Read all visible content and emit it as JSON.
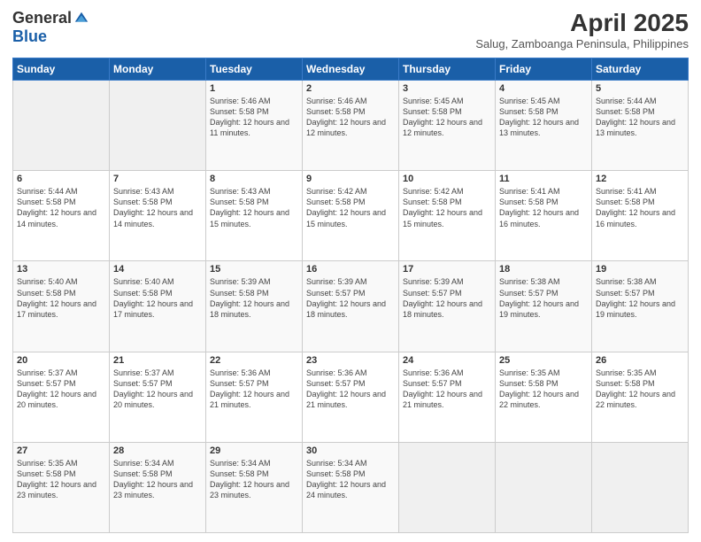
{
  "header": {
    "logo_general": "General",
    "logo_blue": "Blue",
    "month_title": "April 2025",
    "subtitle": "Salug, Zamboanga Peninsula, Philippines"
  },
  "weekdays": [
    "Sunday",
    "Monday",
    "Tuesday",
    "Wednesday",
    "Thursday",
    "Friday",
    "Saturday"
  ],
  "rows": [
    [
      {
        "day": "",
        "info": ""
      },
      {
        "day": "",
        "info": ""
      },
      {
        "day": "1",
        "info": "Sunrise: 5:46 AM\nSunset: 5:58 PM\nDaylight: 12 hours\nand 11 minutes."
      },
      {
        "day": "2",
        "info": "Sunrise: 5:46 AM\nSunset: 5:58 PM\nDaylight: 12 hours\nand 12 minutes."
      },
      {
        "day": "3",
        "info": "Sunrise: 5:45 AM\nSunset: 5:58 PM\nDaylight: 12 hours\nand 12 minutes."
      },
      {
        "day": "4",
        "info": "Sunrise: 5:45 AM\nSunset: 5:58 PM\nDaylight: 12 hours\nand 13 minutes."
      },
      {
        "day": "5",
        "info": "Sunrise: 5:44 AM\nSunset: 5:58 PM\nDaylight: 12 hours\nand 13 minutes."
      }
    ],
    [
      {
        "day": "6",
        "info": "Sunrise: 5:44 AM\nSunset: 5:58 PM\nDaylight: 12 hours\nand 14 minutes."
      },
      {
        "day": "7",
        "info": "Sunrise: 5:43 AM\nSunset: 5:58 PM\nDaylight: 12 hours\nand 14 minutes."
      },
      {
        "day": "8",
        "info": "Sunrise: 5:43 AM\nSunset: 5:58 PM\nDaylight: 12 hours\nand 15 minutes."
      },
      {
        "day": "9",
        "info": "Sunrise: 5:42 AM\nSunset: 5:58 PM\nDaylight: 12 hours\nand 15 minutes."
      },
      {
        "day": "10",
        "info": "Sunrise: 5:42 AM\nSunset: 5:58 PM\nDaylight: 12 hours\nand 15 minutes."
      },
      {
        "day": "11",
        "info": "Sunrise: 5:41 AM\nSunset: 5:58 PM\nDaylight: 12 hours\nand 16 minutes."
      },
      {
        "day": "12",
        "info": "Sunrise: 5:41 AM\nSunset: 5:58 PM\nDaylight: 12 hours\nand 16 minutes."
      }
    ],
    [
      {
        "day": "13",
        "info": "Sunrise: 5:40 AM\nSunset: 5:58 PM\nDaylight: 12 hours\nand 17 minutes."
      },
      {
        "day": "14",
        "info": "Sunrise: 5:40 AM\nSunset: 5:58 PM\nDaylight: 12 hours\nand 17 minutes."
      },
      {
        "day": "15",
        "info": "Sunrise: 5:39 AM\nSunset: 5:58 PM\nDaylight: 12 hours\nand 18 minutes."
      },
      {
        "day": "16",
        "info": "Sunrise: 5:39 AM\nSunset: 5:57 PM\nDaylight: 12 hours\nand 18 minutes."
      },
      {
        "day": "17",
        "info": "Sunrise: 5:39 AM\nSunset: 5:57 PM\nDaylight: 12 hours\nand 18 minutes."
      },
      {
        "day": "18",
        "info": "Sunrise: 5:38 AM\nSunset: 5:57 PM\nDaylight: 12 hours\nand 19 minutes."
      },
      {
        "day": "19",
        "info": "Sunrise: 5:38 AM\nSunset: 5:57 PM\nDaylight: 12 hours\nand 19 minutes."
      }
    ],
    [
      {
        "day": "20",
        "info": "Sunrise: 5:37 AM\nSunset: 5:57 PM\nDaylight: 12 hours\nand 20 minutes."
      },
      {
        "day": "21",
        "info": "Sunrise: 5:37 AM\nSunset: 5:57 PM\nDaylight: 12 hours\nand 20 minutes."
      },
      {
        "day": "22",
        "info": "Sunrise: 5:36 AM\nSunset: 5:57 PM\nDaylight: 12 hours\nand 21 minutes."
      },
      {
        "day": "23",
        "info": "Sunrise: 5:36 AM\nSunset: 5:57 PM\nDaylight: 12 hours\nand 21 minutes."
      },
      {
        "day": "24",
        "info": "Sunrise: 5:36 AM\nSunset: 5:57 PM\nDaylight: 12 hours\nand 21 minutes."
      },
      {
        "day": "25",
        "info": "Sunrise: 5:35 AM\nSunset: 5:58 PM\nDaylight: 12 hours\nand 22 minutes."
      },
      {
        "day": "26",
        "info": "Sunrise: 5:35 AM\nSunset: 5:58 PM\nDaylight: 12 hours\nand 22 minutes."
      }
    ],
    [
      {
        "day": "27",
        "info": "Sunrise: 5:35 AM\nSunset: 5:58 PM\nDaylight: 12 hours\nand 23 minutes."
      },
      {
        "day": "28",
        "info": "Sunrise: 5:34 AM\nSunset: 5:58 PM\nDaylight: 12 hours\nand 23 minutes."
      },
      {
        "day": "29",
        "info": "Sunrise: 5:34 AM\nSunset: 5:58 PM\nDaylight: 12 hours\nand 23 minutes."
      },
      {
        "day": "30",
        "info": "Sunrise: 5:34 AM\nSunset: 5:58 PM\nDaylight: 12 hours\nand 24 minutes."
      },
      {
        "day": "",
        "info": ""
      },
      {
        "day": "",
        "info": ""
      },
      {
        "day": "",
        "info": ""
      }
    ]
  ]
}
